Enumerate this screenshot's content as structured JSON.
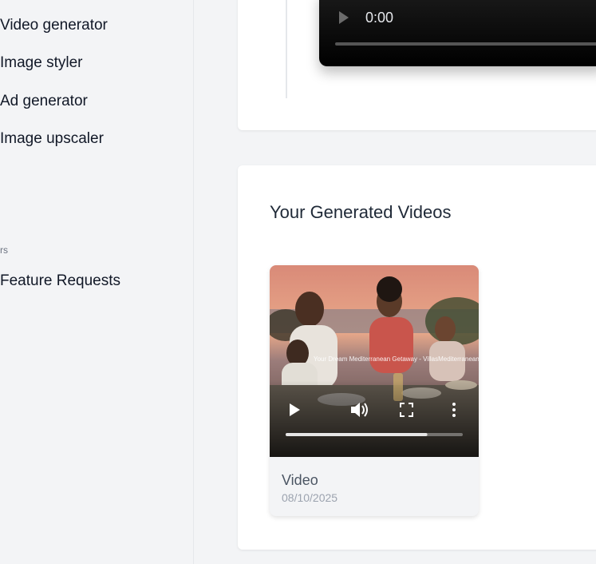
{
  "sidebar": {
    "items": [
      {
        "label": "Video generator"
      },
      {
        "label": "Image styler"
      },
      {
        "label": "Ad generator"
      },
      {
        "label": "Image upscaler"
      }
    ],
    "section_label": "rs",
    "extra_item": {
      "label": "Feature Requests"
    }
  },
  "top_player": {
    "time": "0:00"
  },
  "videos_section": {
    "title": "Your Generated Videos",
    "videos": [
      {
        "watermark": "Your Dream Mediterranean Getaway - VillasMediterranean.com",
        "title": "Video",
        "date": "08/10/2025",
        "progress": 0.8
      }
    ]
  },
  "icons": {
    "play": "play-icon",
    "volume": "volume-icon",
    "fullscreen": "fullscreen-icon",
    "more": "more-vertical-icon"
  }
}
